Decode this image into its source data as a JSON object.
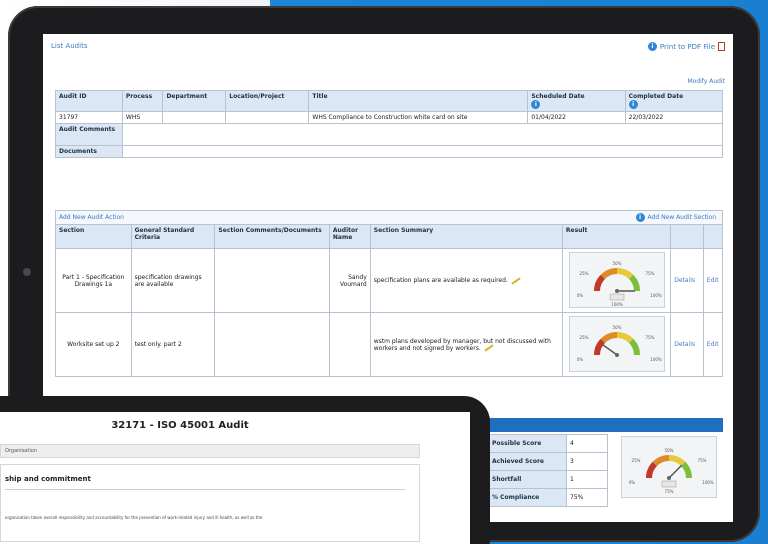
{
  "header": {
    "title": "List Audits",
    "print_label": "Print to PDF File",
    "modify_label": "Modify Audit"
  },
  "audit": {
    "headers": [
      "Audit ID",
      "Process",
      "Department",
      "Location/Project",
      "Title",
      "Scheduled Date",
      "Completed Date"
    ],
    "row": {
      "id": "31797",
      "process": "WHS",
      "department": "",
      "location": "",
      "title": "WHS Compliance to Construction white card on site",
      "scheduled": "01/04/2022",
      "completed": "22/03/2022"
    },
    "comments_label": "Audit Comments",
    "documents_label": "Documents"
  },
  "actions": {
    "add_action_label": "Add New Audit Action",
    "add_section_label": "Add New Audit Section",
    "headers": [
      "Section",
      "General Standard Criteria",
      "Section Comments/Documents",
      "Auditor Name",
      "Section Summary",
      "Result"
    ],
    "rows": [
      {
        "section": "Part 1 - Specification Drawings 1a",
        "criteria": "specification drawings are available",
        "comments": "",
        "auditor": "Sandy Voumard",
        "summary": "specification plans are available as required.",
        "details": "Details",
        "edit": "Edit",
        "gauge": {
          "labels": [
            "0%",
            "25%",
            "50%",
            "75%",
            "100%"
          ],
          "readout": "100%",
          "level": 1.0
        }
      },
      {
        "section": "Worksite set up 2",
        "criteria": "test only. part 2",
        "comments": "",
        "auditor": "",
        "summary": "wstm plans developed by manager, but not discussed with workers and not signed by workers.",
        "details": "Details",
        "edit": "Edit",
        "gauge": {
          "labels": [
            "0%",
            "25%",
            "50%",
            "75%",
            "100%"
          ],
          "readout": "",
          "level": 0.2
        }
      }
    ]
  },
  "scores": {
    "rows": [
      {
        "label": "Possible Score",
        "value": "4"
      },
      {
        "label": "Achieved Score",
        "value": "3"
      },
      {
        "label": "Shortfall",
        "value": "1"
      },
      {
        "label": "% Compliance",
        "value": "75%"
      }
    ],
    "gauge": {
      "labels": [
        "0%",
        "25%",
        "50%",
        "75%",
        "100%"
      ],
      "readout": "75%",
      "level": 0.75
    }
  },
  "second_device": {
    "title": "32171 - ISO 45001 Audit",
    "bar_text": "Organisation",
    "heading": "ship and commitment",
    "body": "organisation taken overall responsibility and accountability for the prevention of work-related injury and ill health, as well as the"
  },
  "colors": {
    "brand": "#1d86d6",
    "header_bg": "#dbe7f4",
    "link": "#3a7bbf"
  }
}
